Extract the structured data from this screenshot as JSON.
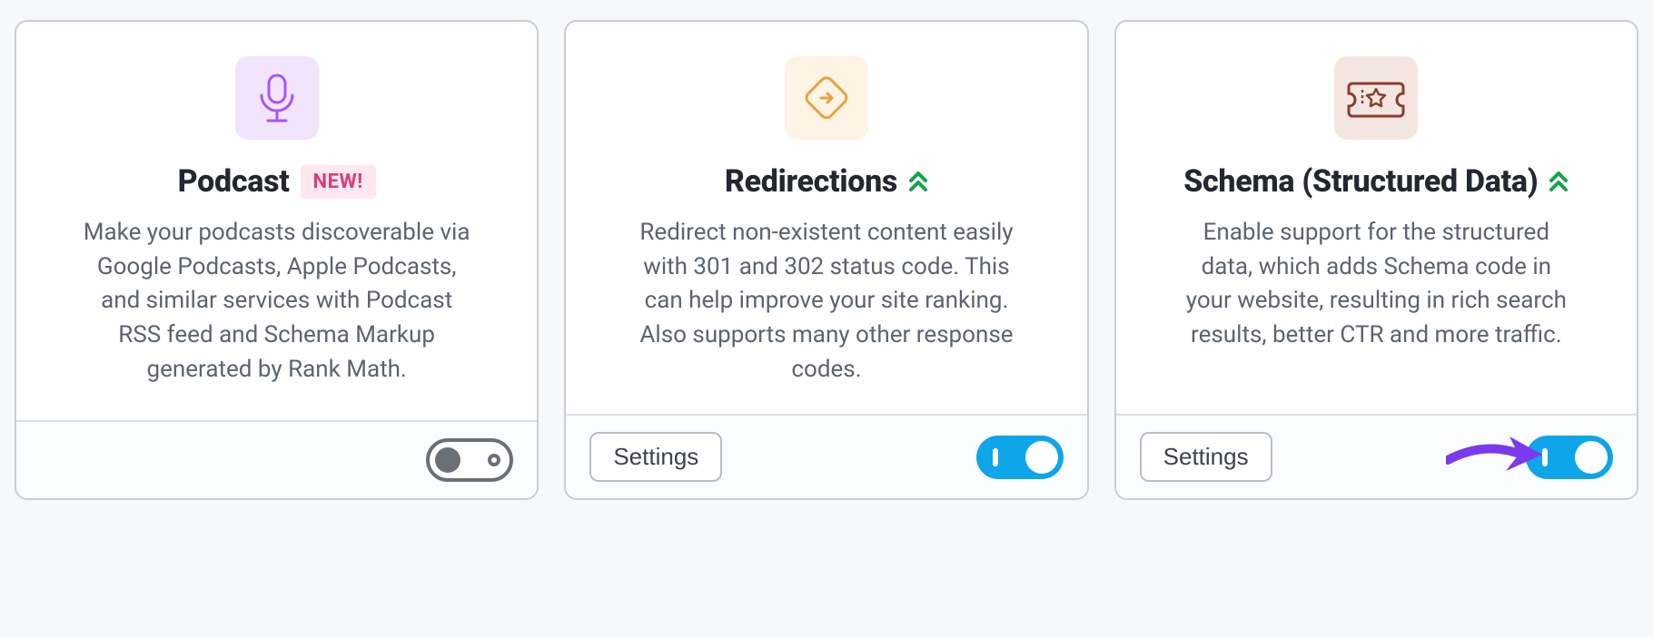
{
  "common": {
    "settings_label": "Settings"
  },
  "cards": {
    "podcast": {
      "title": "Podcast",
      "badge": "NEW!",
      "badge_visible": true,
      "chevron_visible": false,
      "icon": "microphone-icon",
      "icon_theme": "purple",
      "description": "Make your podcasts discoverable via Google Podcasts, Apple Podcasts, and similar services with Podcast RSS feed and Schema Markup generated by Rank Math.",
      "has_settings_button": false,
      "toggle_state": "off",
      "arrow_callout": false
    },
    "redirections": {
      "title": "Redirections",
      "badge": "",
      "badge_visible": false,
      "chevron_visible": true,
      "icon": "redirect-icon",
      "icon_theme": "orange",
      "description": "Redirect non-existent content easily with 301 and 302 status code. This can help improve your site ranking. Also supports many other response codes.",
      "has_settings_button": true,
      "toggle_state": "on",
      "arrow_callout": false
    },
    "schema": {
      "title": "Schema (Structured Data)",
      "badge": "",
      "badge_visible": false,
      "chevron_visible": true,
      "icon": "ticket-star-icon",
      "icon_theme": "brown",
      "description": "Enable support for the structured data, which adds Schema code in your website, resulting in rich search results, better CTR and more traffic.",
      "has_settings_button": true,
      "toggle_state": "on",
      "arrow_callout": true
    }
  }
}
